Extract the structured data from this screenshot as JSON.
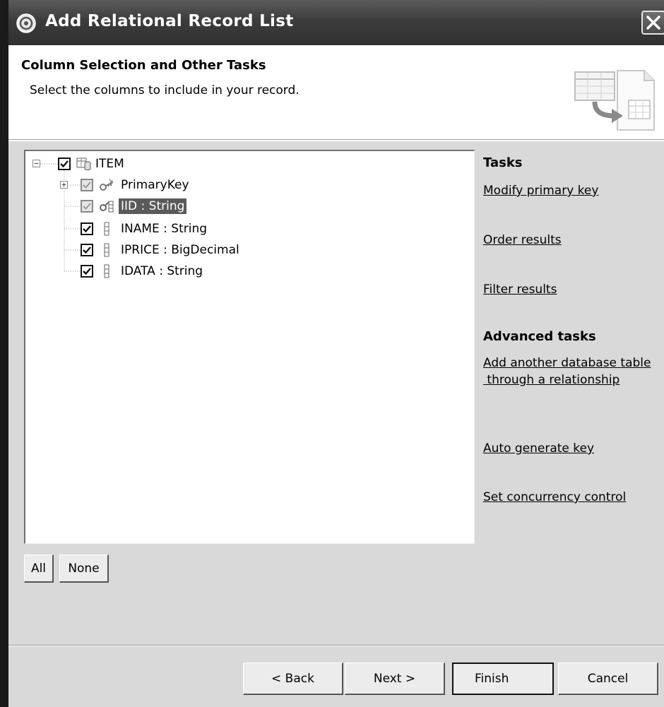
{
  "window": {
    "title": "Add Relational Record List",
    "close_icon": "close-icon"
  },
  "header": {
    "title": "Column Selection and Other Tasks",
    "description": "Select the columns to include in your record."
  },
  "tree": {
    "root": {
      "label": "ITEM",
      "checked": true,
      "expanded": true
    },
    "items": [
      {
        "label": "PrimaryKey",
        "checked": true,
        "greyed": true,
        "expandable": true,
        "icon": "key-icon"
      },
      {
        "label": "IID : String",
        "checked": true,
        "greyed": true,
        "selected": true,
        "icon": "key-column-icon"
      },
      {
        "label": "INAME : String",
        "checked": true,
        "icon": "column-icon"
      },
      {
        "label": "IPRICE : BigDecimal",
        "checked": true,
        "icon": "column-icon"
      },
      {
        "label": "IDATA : String",
        "checked": true,
        "icon": "column-icon"
      }
    ]
  },
  "tasks": {
    "heading": "Tasks",
    "links": [
      "Modify primary key",
      "Order results",
      "Filter results"
    ],
    "advanced_heading": "Advanced tasks",
    "advanced_links": [
      "Add another database table",
      " through a relationship",
      "Auto generate key",
      "Set concurrency control"
    ]
  },
  "selection_buttons": {
    "all": "All",
    "none": "None"
  },
  "footer": {
    "back": "< Back",
    "next": "Next >",
    "finish": "Finish",
    "cancel": "Cancel"
  }
}
